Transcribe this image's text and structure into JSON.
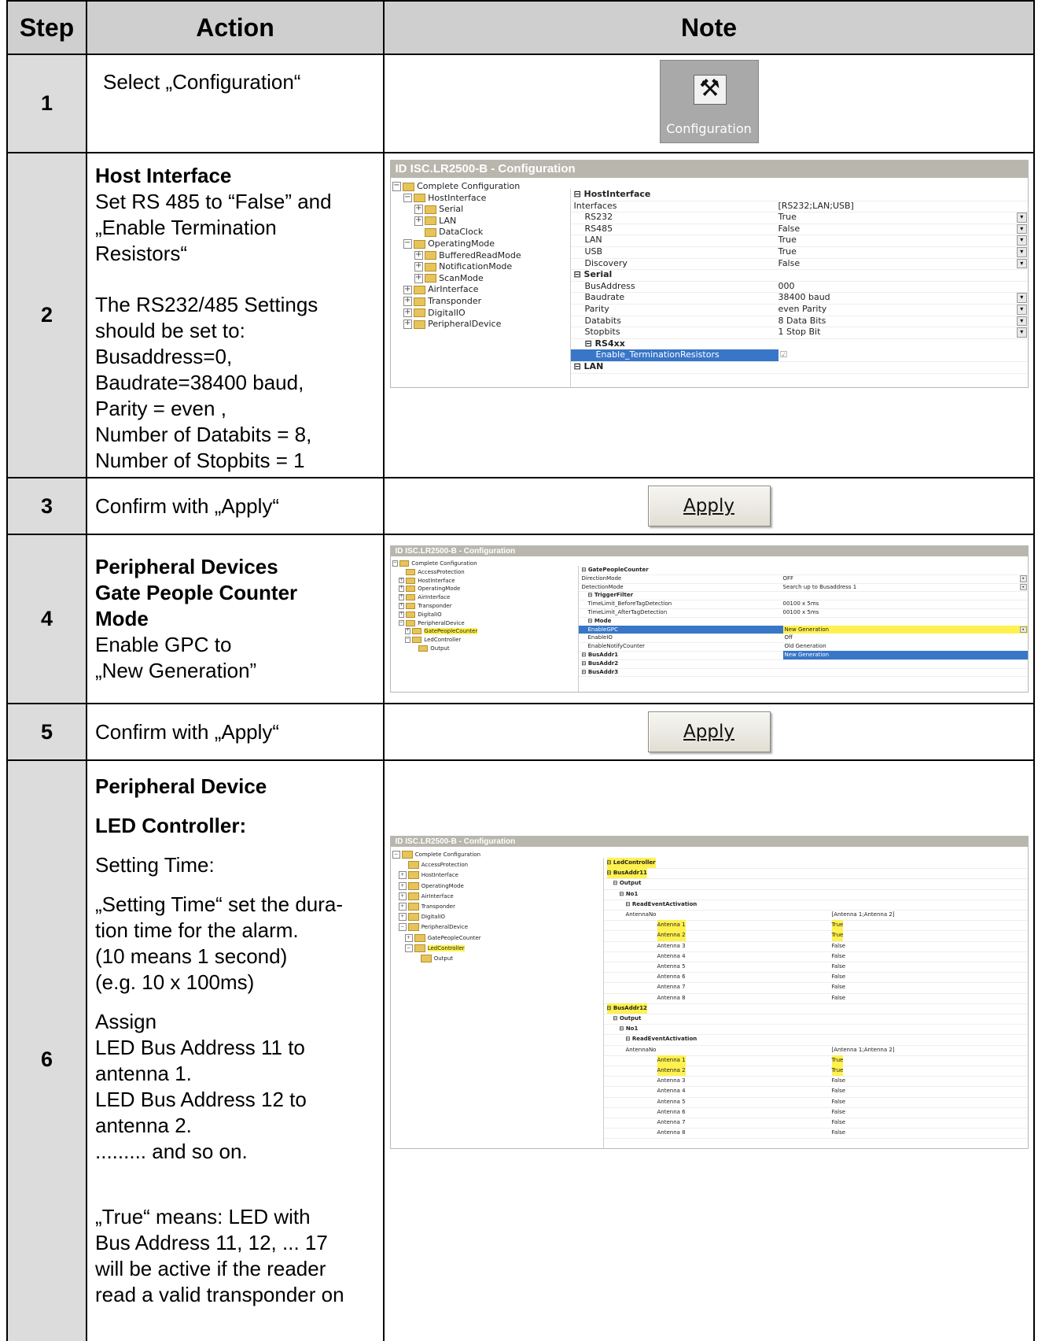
{
  "table": {
    "headers": {
      "step": "Step",
      "action": "Action",
      "note": "Note"
    }
  },
  "steps": {
    "s1": {
      "num": "1",
      "action": "Select „Configuration“",
      "image_label": "Configuration"
    },
    "s2": {
      "num": "2",
      "heading": "Host Interface",
      "lines": [
        "Set RS 485 to “False” and",
        "„Enable Termination",
        "Resistors“"
      ],
      "lines2": [
        "The RS232/485 Settings",
        "should be set to:",
        "Busaddress=0,",
        "Baudrate=38400 baud,",
        "Parity = even ,",
        "Number of Databits = 8,",
        "Number of Stopbits = 1"
      ]
    },
    "s3": {
      "num": "3",
      "action": "Confirm with „Apply“",
      "button": "Apply"
    },
    "s4": {
      "num": "4",
      "headings": [
        "Peripheral Devices",
        "Gate People Counter",
        "Mode"
      ],
      "lines": [
        "Enable GPC to",
        "„New Generation”"
      ]
    },
    "s5": {
      "num": "5",
      "action": "Confirm with „Apply“",
      "button": "Apply"
    },
    "s6": {
      "num": "6",
      "h1": "Peripheral Device",
      "h2": "LED Controller:",
      "t1": "Setting Time:",
      "t2": [
        "„Setting Time“ set the dura-",
        "tion time for the alarm.",
        "(10 means 1 second)",
        "(e.g.  10 x 100ms)"
      ],
      "t3": [
        "Assign",
        "LED Bus Address 11 to",
        "antenna 1.",
        "LED Bus Address 12 to",
        "antenna 2.",
        "......... and so on."
      ],
      "t4": [
        "„True“ means: LED with",
        "Bus Address 11, 12, ... 17",
        "will be active if the reader",
        "read a valid transponder on"
      ]
    }
  },
  "shot2": {
    "title": "ID ISC.LR2500-B - Configuration",
    "tree": [
      "Complete Configuration",
      "HostInterface",
      "Serial",
      "LAN",
      "DataClock",
      "OperatingMode",
      "BufferedReadMode",
      "NotificationMode",
      "ScanMode",
      "AirInterface",
      "Transponder",
      "DigitalIO",
      "PeripheralDevice"
    ],
    "rows": [
      {
        "k": "HostInterface",
        "v": ""
      },
      {
        "k": "Interfaces",
        "v": "[RS232;LAN;USB]"
      },
      {
        "k": "RS232",
        "v": "True"
      },
      {
        "k": "RS485",
        "v": "False"
      },
      {
        "k": "LAN",
        "v": "True"
      },
      {
        "k": "USB",
        "v": "True"
      },
      {
        "k": "Discovery",
        "v": "False"
      },
      {
        "k": "Serial",
        "v": ""
      },
      {
        "k": "BusAddress",
        "v": "000"
      },
      {
        "k": "Baudrate",
        "v": "38400 baud"
      },
      {
        "k": "Parity",
        "v": "even Parity"
      },
      {
        "k": "Databits",
        "v": "8 Data Bits"
      },
      {
        "k": "Stopbits",
        "v": "1 Stop Bit"
      },
      {
        "k": "RS4xx",
        "v": ""
      },
      {
        "k": "Enable_TerminationResistors",
        "v": "☑"
      },
      {
        "k": "LAN",
        "v": ""
      }
    ]
  },
  "shot4": {
    "title": "ID ISC.LR2500-B - Configuration",
    "tree": [
      "Complete Configuration",
      "AccessProtection",
      "HostInterface",
      "OperatingMode",
      "AirInterface",
      "Transponder",
      "DigitalIO",
      "PeripheralDevice",
      "GatePeopleCounter",
      "LedController",
      "Output"
    ],
    "rows": [
      {
        "k": "GatePeopleCounter",
        "v": ""
      },
      {
        "k": "DirectionMode",
        "v": "OFF"
      },
      {
        "k": "DetectionMode",
        "v": "Search up to Busaddress 1"
      },
      {
        "k": "TriggerFilter",
        "v": ""
      },
      {
        "k": "TimeLimit_BeforeTagDetection",
        "v": "00100 x 5ms"
      },
      {
        "k": "TimeLimit_AfterTagDetection",
        "v": "00100 x 5ms"
      },
      {
        "k": "Mode",
        "v": ""
      },
      {
        "k": "EnableGPC",
        "v": "New Generation"
      },
      {
        "k": "EnableIO",
        "v": "Off"
      },
      {
        "k": "EnableNotifyCounter",
        "v": "Old Generation"
      },
      {
        "k": "BusAddr1",
        "v": "New Generation"
      },
      {
        "k": "BusAddr2",
        "v": ""
      },
      {
        "k": "BusAddr3",
        "v": ""
      }
    ]
  },
  "shot6": {
    "title": "ID ISC.LR2500-B - Configuration",
    "tree": [
      "Complete Configuration",
      "AccessProtection",
      "HostInterface",
      "OperatingMode",
      "AirInterface",
      "Transponder",
      "DigitalIO",
      "PeripheralDevice",
      "GatePeopleCounter",
      "LedController",
      "Output"
    ],
    "rows": [
      {
        "k": "LedController",
        "v": ""
      },
      {
        "k": "BusAddr11",
        "v": ""
      },
      {
        "k": "Output",
        "v": ""
      },
      {
        "k": "No1",
        "v": ""
      },
      {
        "k": "ReadEventActivation",
        "v": ""
      },
      {
        "k": "AntennaNo",
        "v": "[Antenna 1;Antenna 2]"
      },
      {
        "k": "Antenna 1",
        "v": "True"
      },
      {
        "k": "Antenna 2",
        "v": "True"
      },
      {
        "k": "Antenna 3",
        "v": "False"
      },
      {
        "k": "Antenna 4",
        "v": "False"
      },
      {
        "k": "Antenna 5",
        "v": "False"
      },
      {
        "k": "Antenna 6",
        "v": "False"
      },
      {
        "k": "Antenna 7",
        "v": "False"
      },
      {
        "k": "Antenna 8",
        "v": "False"
      },
      {
        "k": "BusAddr12",
        "v": ""
      },
      {
        "k": "Output",
        "v": ""
      },
      {
        "k": "No1",
        "v": ""
      },
      {
        "k": "ReadEventActivation",
        "v": ""
      },
      {
        "k": "AntennaNo",
        "v": "[Antenna 1;Antenna 2]"
      },
      {
        "k": "Antenna 1",
        "v": "True"
      },
      {
        "k": "Antenna 2",
        "v": "True"
      },
      {
        "k": "Antenna 3",
        "v": "False"
      },
      {
        "k": "Antenna 4",
        "v": "False"
      },
      {
        "k": "Antenna 5",
        "v": "False"
      },
      {
        "k": "Antenna 6",
        "v": "False"
      },
      {
        "k": "Antenna 7",
        "v": "False"
      },
      {
        "k": "Antenna 8",
        "v": "False"
      }
    ]
  }
}
